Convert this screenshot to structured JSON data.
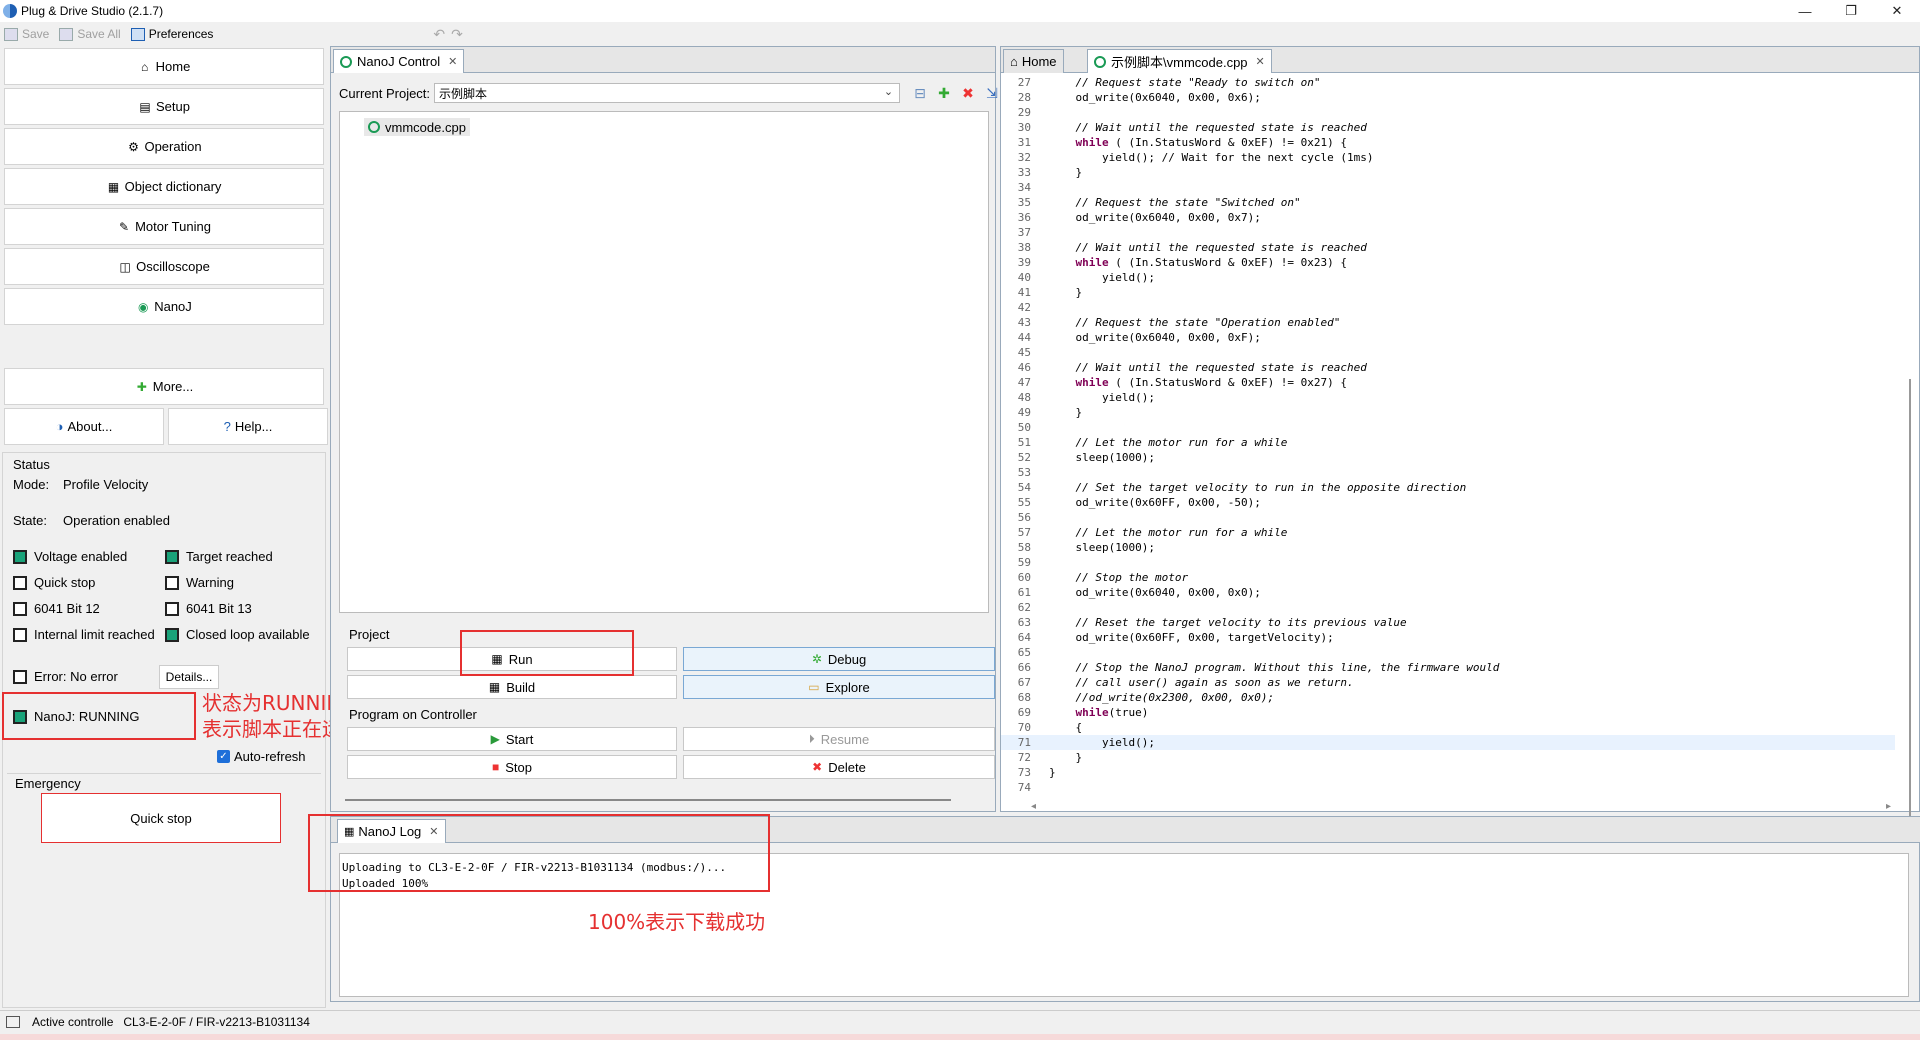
{
  "window": {
    "title": "Plug & Drive Studio (2.1.7)",
    "controls": [
      "—",
      "❐",
      "✕"
    ]
  },
  "toolbar": {
    "save": "Save",
    "save_all": "Save All",
    "preferences": "Preferences"
  },
  "nav": {
    "items": [
      {
        "label": "Home",
        "icon": "house-icon"
      },
      {
        "label": "Setup",
        "icon": "setup-icon"
      },
      {
        "label": "Operation",
        "icon": "gear-icon"
      },
      {
        "label": "Object dictionary",
        "icon": "dictionary-icon"
      },
      {
        "label": "Motor Tuning",
        "icon": "wrench-icon"
      },
      {
        "label": "Oscilloscope",
        "icon": "oscilloscope-icon"
      },
      {
        "label": "NanoJ",
        "icon": "nanoj-icon"
      }
    ],
    "more": "More...",
    "about": "About...",
    "help": "Help..."
  },
  "status": {
    "title": "Status",
    "mode_label": "Mode:",
    "mode_value": "Profile Velocity",
    "state_label": "State:",
    "state_value": "Operation enabled",
    "flags": [
      {
        "label": "Voltage enabled",
        "on": true
      },
      {
        "label": "Target reached",
        "on": true
      },
      {
        "label": "Quick stop",
        "on": false
      },
      {
        "label": "Warning",
        "on": false
      },
      {
        "label": "6041 Bit 12",
        "on": false
      },
      {
        "label": "6041 Bit 13",
        "on": false
      },
      {
        "label": "Internal limit reached",
        "on": false
      },
      {
        "label": "Closed loop available",
        "on": true
      }
    ],
    "error_label": "Error:",
    "error_value": "No error",
    "details": "Details...",
    "nanoj_label": "NanoJ:",
    "nanoj_value": "RUNNING",
    "auto_refresh": "Auto-refresh",
    "emergency": "Emergency",
    "quick_stop": "Quick stop"
  },
  "annotations": {
    "running_line1": "状态为RUNNING",
    "running_line2": "表示脚本正在运行",
    "upload_done": "100%表示下载成功"
  },
  "nanoj_control": {
    "tab": "NanoJ Control",
    "current_project_label": "Current Project:",
    "current_project": "示例脚本",
    "file": "vmmcode.cpp",
    "project_label": "Project",
    "run": "Run",
    "debug": "Debug",
    "build": "Build",
    "explore": "Explore",
    "program_label": "Program on Controller",
    "start": "Start",
    "resume": "Resume",
    "stop": "Stop",
    "delete": "Delete"
  },
  "editor": {
    "tab_home": "Home",
    "tab_file": "示例脚本\\vmmcode.cpp",
    "lines": [
      {
        "n": "27",
        "t": "    // Request state \"Ready to switch on\"",
        "c": true
      },
      {
        "n": "28",
        "t": "    od_write(0x6040, 0x00, 0x6);"
      },
      {
        "n": "29",
        "t": ""
      },
      {
        "n": "30",
        "t": "    // Wait until the requested state is reached",
        "c": true
      },
      {
        "n": "31",
        "t": "    while ( (In.StatusWord & 0xEF) != 0x21) {"
      },
      {
        "n": "32",
        "t": "        yield(); // Wait for the next cycle (1ms)"
      },
      {
        "n": "33",
        "t": "    }"
      },
      {
        "n": "34",
        "t": ""
      },
      {
        "n": "35",
        "t": "    // Request the state \"Switched on\"",
        "c": true
      },
      {
        "n": "36",
        "t": "    od_write(0x6040, 0x00, 0x7);"
      },
      {
        "n": "37",
        "t": ""
      },
      {
        "n": "38",
        "t": "    // Wait until the requested state is reached",
        "c": true
      },
      {
        "n": "39",
        "t": "    while ( (In.StatusWord & 0xEF) != 0x23) {"
      },
      {
        "n": "40",
        "t": "        yield();"
      },
      {
        "n": "41",
        "t": "    }"
      },
      {
        "n": "42",
        "t": ""
      },
      {
        "n": "43",
        "t": "    // Request the state \"Operation enabled\"",
        "c": true
      },
      {
        "n": "44",
        "t": "    od_write(0x6040, 0x00, 0xF);"
      },
      {
        "n": "45",
        "t": ""
      },
      {
        "n": "46",
        "t": "    // Wait until the requested state is reached",
        "c": true
      },
      {
        "n": "47",
        "t": "    while ( (In.StatusWord & 0xEF) != 0x27) {"
      },
      {
        "n": "48",
        "t": "        yield();"
      },
      {
        "n": "49",
        "t": "    }"
      },
      {
        "n": "50",
        "t": ""
      },
      {
        "n": "51",
        "t": "    // Let the motor run for a while",
        "c": true
      },
      {
        "n": "52",
        "t": "    sleep(1000);"
      },
      {
        "n": "53",
        "t": ""
      },
      {
        "n": "54",
        "t": "    // Set the target velocity to run in the opposite direction",
        "c": true
      },
      {
        "n": "55",
        "t": "    od_write(0x60FF, 0x00, -50);"
      },
      {
        "n": "56",
        "t": ""
      },
      {
        "n": "57",
        "t": "    // Let the motor run for a while",
        "c": true
      },
      {
        "n": "58",
        "t": "    sleep(1000);"
      },
      {
        "n": "59",
        "t": ""
      },
      {
        "n": "60",
        "t": "    // Stop the motor",
        "c": true
      },
      {
        "n": "61",
        "t": "    od_write(0x6040, 0x00, 0x0);"
      },
      {
        "n": "62",
        "t": ""
      },
      {
        "n": "63",
        "t": "    // Reset the target velocity to its previous value",
        "c": true
      },
      {
        "n": "64",
        "t": "    od_write(0x60FF, 0x00, targetVelocity);"
      },
      {
        "n": "65",
        "t": ""
      },
      {
        "n": "66",
        "t": "    // Stop the NanoJ program. Without this line, the firmware would",
        "c": true
      },
      {
        "n": "67",
        "t": "    // call user() again as soon as we return.",
        "c": true
      },
      {
        "n": "68",
        "t": "    //od_write(0x2300, 0x00, 0x0);",
        "c": true
      },
      {
        "n": "69",
        "t": "    while(true)"
      },
      {
        "n": "70",
        "t": "    {"
      },
      {
        "n": "71",
        "t": "        yield();",
        "cur": true
      },
      {
        "n": "72",
        "t": "    }"
      },
      {
        "n": "73",
        "t": "}"
      },
      {
        "n": "74",
        "t": ""
      }
    ]
  },
  "log": {
    "tab": "NanoJ Log",
    "lines": [
      "Uploading to CL3-E-2-0F / FIR-v2213-B1031134 (modbus:/)...",
      "Uploaded 100%"
    ]
  },
  "statusbar": {
    "label": "Active controlle",
    "value": "CL3-E-2-0F / FIR-v2213-B1031134"
  },
  "colors": {
    "accent_red": "#e53030",
    "led_green": "#1aa37a"
  }
}
